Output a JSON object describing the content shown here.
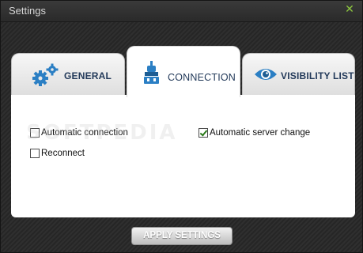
{
  "window": {
    "title": "Settings",
    "close_glyph": "✕",
    "close_color": "#8cc63f"
  },
  "tabs": [
    {
      "label": "GENERAL",
      "icon": "gears-icon",
      "active": false
    },
    {
      "label": "CONNECTION",
      "icon": "network-plug-icon",
      "active": true
    },
    {
      "label": "VISIBILITY LIST",
      "icon": "eye-icon",
      "active": false
    }
  ],
  "connection": {
    "automatic_connection": {
      "label": "Automatic connection",
      "checked": false
    },
    "reconnect": {
      "label": "Reconnect",
      "checked": false
    },
    "automatic_server_change": {
      "label": "Automatic server change",
      "checked": true
    }
  },
  "watermark": "SOFTPEDIA",
  "apply_button": {
    "label": "APPLY SETTINGS"
  },
  "colors": {
    "tab_text": "#233a5a",
    "icon_blue": "#2b7fc4",
    "check_green": "#2a7a1a"
  }
}
